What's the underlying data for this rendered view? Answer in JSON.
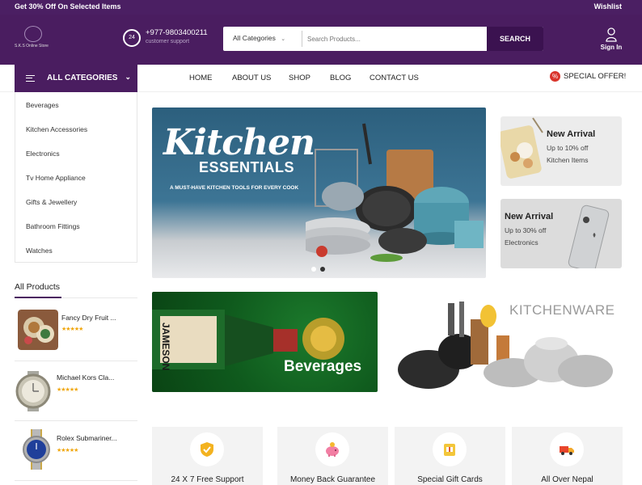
{
  "topbar": {
    "promo": "Get 30% Off On Selected Items",
    "wishlist": "Wishlist"
  },
  "header": {
    "logo_text": "S.K.S Online Store",
    "phone": "+977-9803400211",
    "support_label": "customer support",
    "support_badge": "24",
    "search": {
      "category": "All Categories",
      "placeholder": "Search Products...",
      "button": "SEARCH"
    },
    "signin": "Sign In"
  },
  "nav": {
    "all_categories": "ALL CATEGORIES",
    "menu": [
      "HOME",
      "ABOUT US",
      "SHOP",
      "BLOG",
      "CONTACT US"
    ],
    "special_offer": "SPECIAL OFFER!",
    "offer_badge": "%"
  },
  "categories": [
    "Beverages",
    "Kitchen Accessories",
    "Electronics",
    "Tv Home Appliance",
    "Gifts & Jewellery",
    "Bathroom Fittings",
    "Watches"
  ],
  "all_products": {
    "title": "All Products",
    "items": [
      {
        "title": "Fancy Dry Fruit ...",
        "stars": "★★★★★"
      },
      {
        "title": "Michael Kors Cla...",
        "stars": "★★★★★"
      },
      {
        "title": "Rolex Submariner...",
        "stars": "★★★★★"
      }
    ]
  },
  "hero": {
    "title": "Kitchen",
    "subtitle": "ESSENTIALS",
    "tagline": "A MUST-HAVE KITCHEN TOOLS FOR EVERY COOK",
    "active_slide": 2,
    "slides": 2
  },
  "side_banners": [
    {
      "heading": "New Arrival",
      "line1": "Up to 10% off",
      "line2": "Kitchen Items"
    },
    {
      "heading": "New Arrival",
      "line1": "Up to 30% off",
      "line2": "Electronics"
    }
  ],
  "promos": {
    "beverages_label": "Beverages",
    "bottle_label": "JAMESON",
    "kitchenware_label": "KITCHENWARE"
  },
  "features": [
    {
      "label": "24 X 7 Free Support",
      "icon": "shield-check-icon"
    },
    {
      "label": "Money Back Guarantee",
      "icon": "piggy-bank-icon"
    },
    {
      "label": "Special Gift Cards",
      "icon": "gift-card-icon"
    },
    {
      "label": "All Over Nepal",
      "icon": "delivery-truck-icon"
    }
  ],
  "colors": {
    "brand": "#4a1d60",
    "accent_star": "#f0a70f",
    "offer_red": "#d9342b"
  }
}
